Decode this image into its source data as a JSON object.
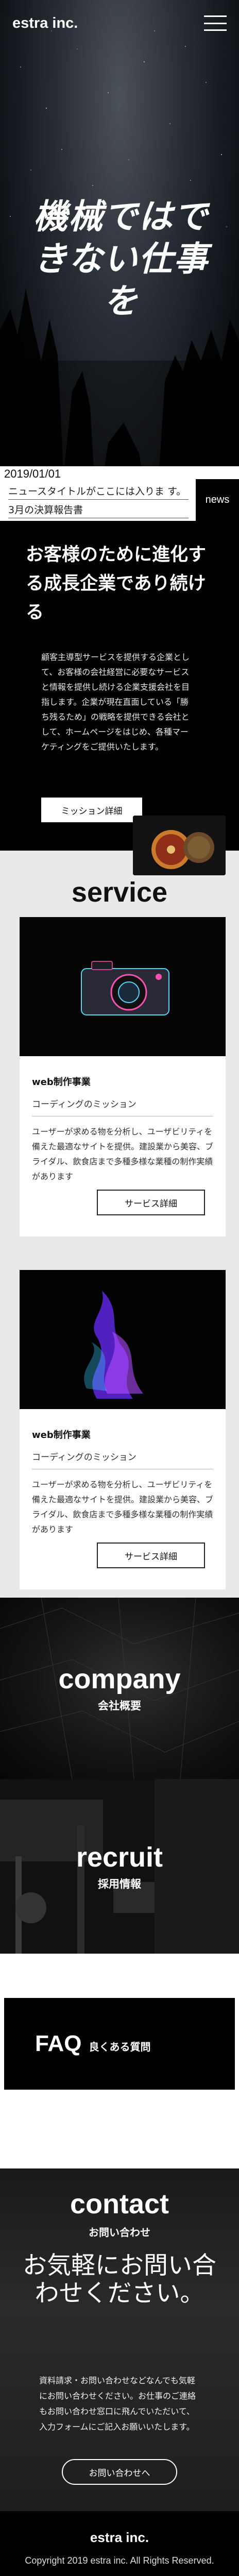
{
  "header": {
    "logo": "estra inc.",
    "menu_icon": "hamburger-menu-icon"
  },
  "hero": {
    "title": "機械ではできない仕事を"
  },
  "news": {
    "date": "2019/01/01",
    "items": [
      "ニュースタイトルがここには入りま す。",
      "3月の決算報告書"
    ],
    "tag": "news"
  },
  "mission": {
    "title": "お客様のために進化する成長企業であり続ける",
    "body": "顧客主導型サービスを提供する企業として、お客様の会社経営に必要なサービスと情報を提供し続ける企業支援会社を目指します。企業が現在直面している「勝ち残るため」の戦略を提供できる会社として、ホームページをはじめ、各種マーケティングをご提供いたします。",
    "button": "ミッション詳細"
  },
  "service": {
    "heading": "service",
    "cards": [
      {
        "image_icon": "camera-photo-icon",
        "category": "web制作事業",
        "subtitle": "コーディングのミッション",
        "text": "ユーザーが求める物を分析し、ユーザビリティを備えた最適なサイトを提供。建設業から美容、ブライダル、飲食店まで多種多様な業種の制作実績があります",
        "button": "サービス詳細"
      },
      {
        "image_icon": "purple-smoke-photo-icon",
        "category": "web制作事業",
        "subtitle": "コーディングのミッション",
        "text": "ユーザーが求める物を分析し、ユーザビリティを備えた最適なサイトを提供。建設業から美容、ブライダル、飲食店まで多種多様な業種の制作実績があります",
        "button": "サービス詳細"
      }
    ]
  },
  "company": {
    "en": "company",
    "ja": "会社概要"
  },
  "recruit": {
    "en": "recruit",
    "ja": "採用情報"
  },
  "faq": {
    "en": "FAQ",
    "ja": "良くある質問"
  },
  "contact": {
    "en": "contact",
    "ja": "お問い合わせ",
    "title": "お気軽にお問い合わせください。",
    "body": "資料請求・お問い合わせなどなんでも気軽にお問い合わせください。お仕事のご連絡もお問い合わせ窓口に飛んでいただいて、入力フォームにご記入お願いいたします。",
    "button": "お問い合わせへ"
  },
  "footer": {
    "logo": "estra inc.",
    "copyright": "Copyright 2019 estra inc. All Rights Reserved."
  },
  "colors": {
    "background": "#000000",
    "service_bg": "#e9e9e9",
    "accent_purple": "#7a3cff"
  }
}
